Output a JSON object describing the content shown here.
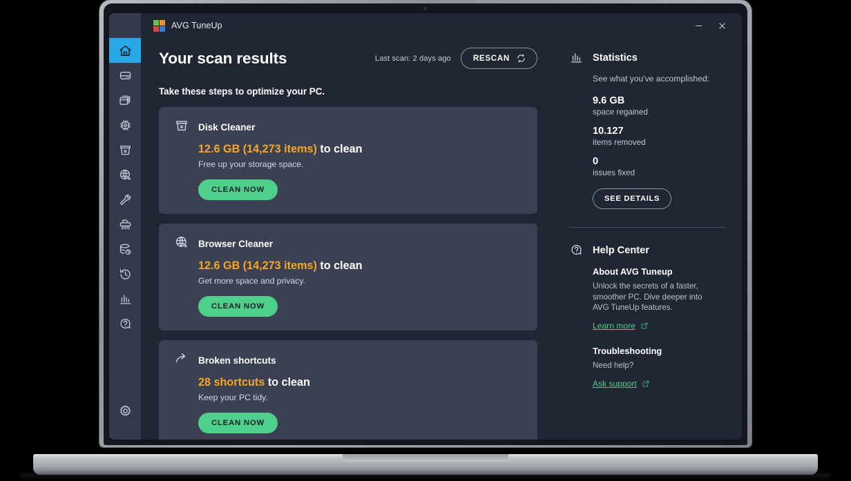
{
  "window": {
    "app_title": "AVG TuneUp",
    "logo_colors": [
      "#6bbf4a",
      "#f0932b",
      "#d94a3d",
      "#2f7fd6"
    ],
    "minimize_label": "Minimize",
    "close_label": "Close"
  },
  "sidebar": {
    "items": [
      {
        "name": "home",
        "icon": "home-icon",
        "active": true
      },
      {
        "name": "disk",
        "icon": "hard-drive-icon",
        "active": false
      },
      {
        "name": "programs",
        "icon": "windows-layers-icon",
        "active": false
      },
      {
        "name": "performance",
        "icon": "cpu-chip-icon",
        "active": false
      },
      {
        "name": "disk-cleaner",
        "icon": "trash-bin-icon",
        "active": false
      },
      {
        "name": "browser-cleaner",
        "icon": "globe-cursor-icon",
        "active": false
      },
      {
        "name": "tools",
        "icon": "wrench-icon",
        "active": false
      },
      {
        "name": "shredder",
        "icon": "shredder-icon",
        "active": false
      },
      {
        "name": "backup",
        "icon": "database-restore-icon",
        "active": false
      },
      {
        "name": "history",
        "icon": "clock-history-icon",
        "active": false
      },
      {
        "name": "statistics",
        "icon": "bar-chart-icon",
        "active": false
      },
      {
        "name": "help",
        "icon": "question-bubble-icon",
        "active": false
      }
    ],
    "settings": {
      "name": "settings",
      "icon": "gear-icon"
    }
  },
  "main": {
    "page_title": "Your scan results",
    "last_scan": "Last scan: 2 days ago",
    "rescan_label": "RESCAN",
    "subtitle": "Take these steps to optimize your PC.",
    "cards": [
      {
        "title": "Disk Cleaner",
        "icon": "trash-bin-icon",
        "amount": "12.6 GB (14,273 items)",
        "metric_suffix": " to clean",
        "description": "Free up your storage space.",
        "button_label": "CLEAN NOW"
      },
      {
        "title": "Browser Cleaner",
        "icon": "globe-cursor-icon",
        "amount": "12.6 GB (14,273 items)",
        "metric_suffix": " to clean",
        "description": "Get more space and privacy.",
        "button_label": "CLEAN NOW"
      },
      {
        "title": "Broken shortcuts",
        "icon": "shortcut-arrow-icon",
        "amount": "28 shortcuts",
        "metric_suffix": " to clean",
        "description": "Keep your PC tidy.",
        "button_label": "CLEAN NOW"
      }
    ]
  },
  "statistics": {
    "title": "Statistics",
    "icon": "bar-chart-icon",
    "subtitle": "See what you've accomplished:",
    "items": [
      {
        "value": "9.6 GB",
        "label": "space regained"
      },
      {
        "value": "10.127",
        "label": "items removed"
      },
      {
        "value": "0",
        "label": "issues fixed"
      }
    ],
    "see_details_label": "SEE DETAILS"
  },
  "help_center": {
    "title": "Help Center",
    "icon": "question-bubble-icon",
    "blocks": [
      {
        "heading": "About AVG Tuneup",
        "text": "Unlock the secrets of a faster, smoother PC. Dive deeper into AVG TuneUp features.",
        "link_label": "Learn more"
      },
      {
        "heading": "Troubleshooting",
        "text": "Need help?",
        "link_label": "Ask support"
      }
    ]
  },
  "theme": {
    "accent_blue": "#29a8e8",
    "accent_green": "#4ed08a",
    "accent_orange": "#f5a623",
    "page_bg": "#212634",
    "card_bg": "#3b4153",
    "rail_bg": "#343a4c"
  }
}
